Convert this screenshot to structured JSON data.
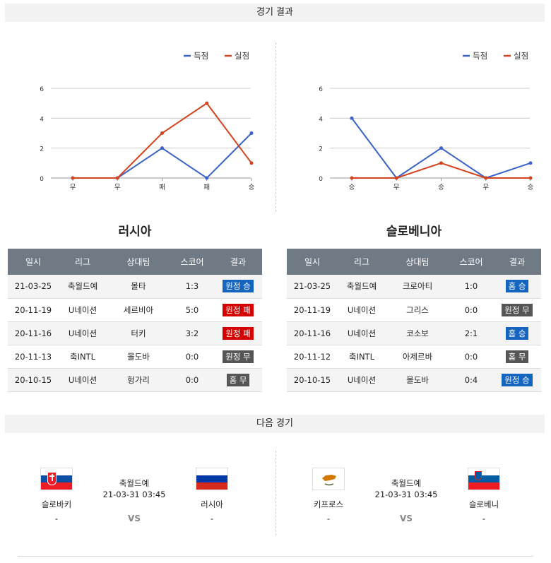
{
  "headers": {
    "results": "경기 결과",
    "next": "다음 경기"
  },
  "legend": {
    "scored": "득점",
    "conceded": "실점"
  },
  "colors": {
    "scored": "#3a62c8",
    "conceded": "#d5421e",
    "win": "#1565c0",
    "loss": "#d50000",
    "draw": "#555555",
    "header_bg": "#6f7a85"
  },
  "chart_data": [
    {
      "type": "line",
      "title": "",
      "categories": [
        "무",
        "무",
        "패",
        "패",
        "승"
      ],
      "ylim": [
        0,
        6
      ],
      "yticks": [
        0,
        2,
        4,
        6
      ],
      "series": [
        {
          "name": "득점",
          "values": [
            0,
            0,
            2,
            0,
            3
          ]
        },
        {
          "name": "실점",
          "values": [
            0,
            0,
            3,
            5,
            1
          ]
        }
      ],
      "grid": true,
      "legend_position": "top-right"
    },
    {
      "type": "line",
      "title": "",
      "categories": [
        "승",
        "무",
        "승",
        "무",
        "승"
      ],
      "ylim": [
        0,
        6
      ],
      "yticks": [
        0,
        2,
        4,
        6
      ],
      "series": [
        {
          "name": "득점",
          "values": [
            4,
            0,
            2,
            0,
            1
          ]
        },
        {
          "name": "실점",
          "values": [
            0,
            0,
            1,
            0,
            0
          ]
        }
      ],
      "grid": true,
      "legend_position": "top-right"
    }
  ],
  "table_columns": [
    "일시",
    "리그",
    "상대팀",
    "스코어",
    "결과"
  ],
  "left": {
    "team": "러시아",
    "rows": [
      {
        "date": "21-03-25",
        "league": "축월드예",
        "opponent": "몰타",
        "score": "1:3",
        "result": "원정 승",
        "kind": "win"
      },
      {
        "date": "20-11-19",
        "league": "U네이션",
        "opponent": "세르비아",
        "score": "5:0",
        "result": "원정 패",
        "kind": "loss"
      },
      {
        "date": "20-11-16",
        "league": "U네이션",
        "opponent": "터키",
        "score": "3:2",
        "result": "원정 패",
        "kind": "loss"
      },
      {
        "date": "20-11-13",
        "league": "축INTL",
        "opponent": "몰도바",
        "score": "0:0",
        "result": "원정 무",
        "kind": "draw"
      },
      {
        "date": "20-10-15",
        "league": "U네이션",
        "opponent": "헝가리",
        "score": "0:0",
        "result": "홈 무",
        "kind": "draw"
      }
    ]
  },
  "right": {
    "team": "슬로베니아",
    "rows": [
      {
        "date": "21-03-25",
        "league": "축월드예",
        "opponent": "크로아티",
        "score": "1:0",
        "result": "홈 승",
        "kind": "win"
      },
      {
        "date": "20-11-19",
        "league": "U네이션",
        "opponent": "그리스",
        "score": "0:0",
        "result": "원정 무",
        "kind": "draw"
      },
      {
        "date": "20-11-16",
        "league": "U네이션",
        "opponent": "코소보",
        "score": "2:1",
        "result": "홈 승",
        "kind": "win"
      },
      {
        "date": "20-11-12",
        "league": "축INTL",
        "opponent": "아제르바",
        "score": "0:0",
        "result": "홈 무",
        "kind": "draw"
      },
      {
        "date": "20-10-15",
        "league": "U네이션",
        "opponent": "몰도바",
        "score": "0:4",
        "result": "원정 승",
        "kind": "win"
      }
    ]
  },
  "next_matches": [
    {
      "home": "슬로바키",
      "away": "러시아",
      "home_flag": "slovakia-flag",
      "away_flag": "russia-flag",
      "league": "축월드예",
      "datetime": "21-03-31 03:45",
      "vs": "VS",
      "home_dash": "-",
      "away_dash": "-"
    },
    {
      "home": "키프로스",
      "away": "슬로베니",
      "home_flag": "cyprus-flag",
      "away_flag": "slovenia-flag",
      "league": "축월드예",
      "datetime": "21-03-31 03:45",
      "vs": "VS",
      "home_dash": "-",
      "away_dash": "-"
    }
  ]
}
